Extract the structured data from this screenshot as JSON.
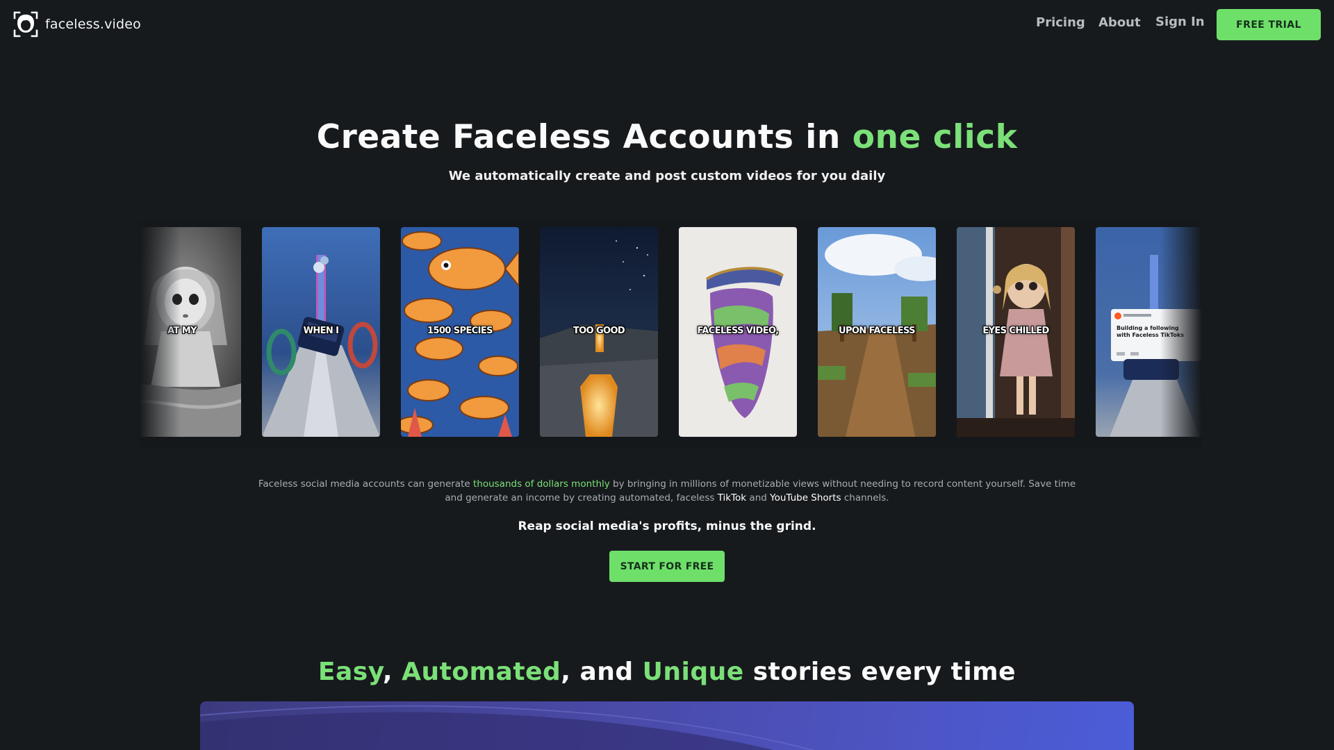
{
  "nav": {
    "brand": "faceless.video",
    "links": [
      "Pricing",
      "About",
      "Sign In"
    ],
    "cta": "FREE TRIAL"
  },
  "hero": {
    "title_main": "Create Faceless Accounts in ",
    "title_accent": "one click",
    "subtitle": "We automatically create and post custom videos for you daily"
  },
  "carousel": {
    "cards": [
      {
        "caption": "AT MY",
        "theme": "doll-bw"
      },
      {
        "caption": "WHEN I",
        "theme": "car-stunt"
      },
      {
        "caption": "1500 SPECIES",
        "theme": "fish"
      },
      {
        "caption": "TOO GOOD",
        "theme": "night-lava"
      },
      {
        "caption": "FACELESS VIDEO,",
        "theme": "soap-cut"
      },
      {
        "caption": "UPON FACELESS",
        "theme": "minecraft"
      },
      {
        "caption": "EYES CHILLED",
        "theme": "doll-door"
      },
      {
        "caption": "",
        "theme": "reddit-post"
      }
    ],
    "partial_card_text": {
      "title": "Building a following with Faceless TikToks"
    }
  },
  "body": {
    "p1": "Faceless social media accounts can generate ",
    "p_green": "thousands of dollars monthly",
    "p2": " by bringing in millions of monetizable views without needing to record content yourself. Save time and generate an income by creating automated, faceless ",
    "tiktok": "TikTok",
    "p3": " and ",
    "shorts": "YouTube Shorts",
    "p4": " channels."
  },
  "reap": "Reap social media's profits, minus the grind.",
  "start_cta": "START FOR FREE",
  "section2": {
    "w1": "Easy",
    "s1": ", ",
    "w2": "Automated",
    "s2": ", and ",
    "w3": "Unique",
    "s3": " stories every time"
  },
  "colors": {
    "background": "#171a1d",
    "accent_green": "#7be078",
    "button_green": "#6ee06a"
  }
}
